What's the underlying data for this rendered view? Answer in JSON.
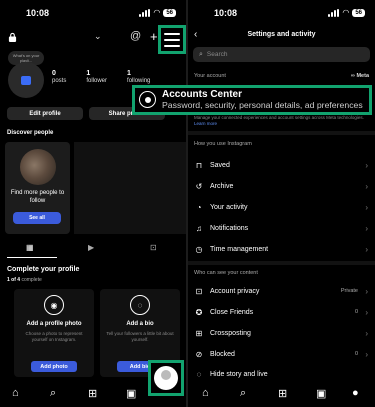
{
  "left": {
    "status": {
      "time": "10:08",
      "battery": "56"
    },
    "note": "What's on your playli...",
    "stats": [
      {
        "value": "0",
        "label": "posts"
      },
      {
        "value": "1",
        "label": "follower"
      },
      {
        "value": "1",
        "label": "following"
      }
    ],
    "buttons": {
      "edit_profile": "Edit profile",
      "share_profile": "Share profile"
    },
    "discover": {
      "title": "Discover people",
      "card_text": "Find more people to follow",
      "card_button": "See all"
    },
    "complete": {
      "title": "Complete your profile",
      "count": "1 of 4",
      "count_suffix": "complete",
      "tasks": [
        {
          "title": "Add a profile photo",
          "desc": "Choose a photo to represent yourself on Instagram.",
          "button": "Add photo"
        },
        {
          "title": "Add a bio",
          "desc": "Tell your followers a little bit about yourself.",
          "button": "Add bio"
        }
      ]
    }
  },
  "right": {
    "status": {
      "time": "10:08",
      "battery": "56"
    },
    "title": "Settings and activity",
    "search_placeholder": "Search",
    "your_account_label": "Your account",
    "meta_label": "Meta",
    "accounts_center": {
      "title": "Accounts Center",
      "subtitle": "Password, security, personal details, ad preferences"
    },
    "meta_desc": "Manage your connected experiences and account settings across Meta technologies.",
    "learn_more": "Learn more",
    "how_you_use_label": "How you use Instagram",
    "how_items": [
      {
        "icon": "bookmark-icon",
        "label": "Saved"
      },
      {
        "icon": "archive-icon",
        "label": "Archive"
      },
      {
        "icon": "activity-icon",
        "label": "Your activity"
      },
      {
        "icon": "bell-icon",
        "label": "Notifications"
      },
      {
        "icon": "clock-icon",
        "label": "Time management"
      }
    ],
    "who_label": "Who can see your content",
    "who_items": [
      {
        "icon": "lock-icon",
        "label": "Account privacy",
        "value": "Private"
      },
      {
        "icon": "star-icon",
        "label": "Close Friends",
        "value": "0"
      },
      {
        "icon": "grid-icon",
        "label": "Crossposting",
        "value": ""
      },
      {
        "icon": "block-icon",
        "label": "Blocked",
        "value": "0"
      },
      {
        "icon": "hide-icon",
        "label": "Hide story and live",
        "value": ""
      }
    ]
  }
}
